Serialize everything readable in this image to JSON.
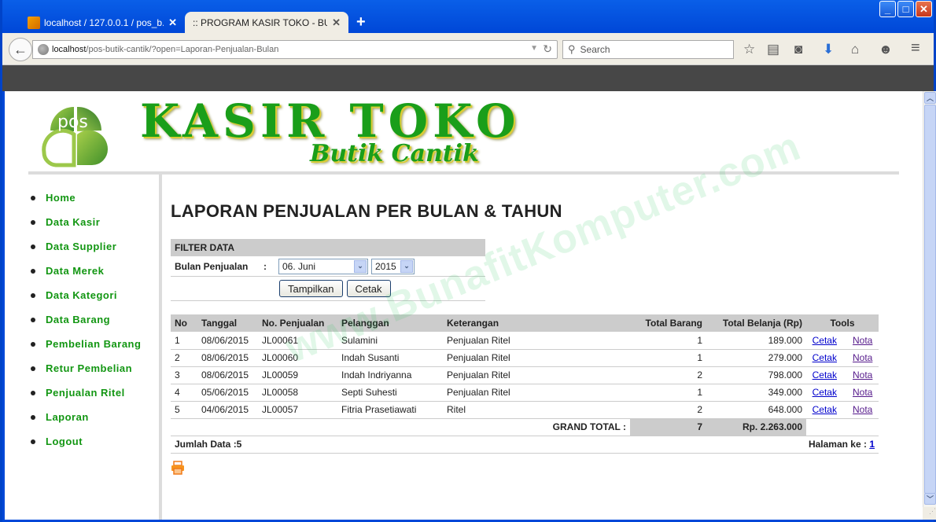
{
  "browser": {
    "tabs": [
      {
        "label": "localhost / 127.0.0.1 / pos_b...",
        "active": false
      },
      {
        "label": ":: PROGRAM KASIR TOKO - BUTIK...",
        "active": true
      }
    ],
    "url_host": "localhost",
    "url_path": "/pos-butik-cantik/?open=Laporan-Penjualan-Bulan",
    "search_placeholder": "Search",
    "window_buttons": {
      "minimize": "_",
      "maximize": "□",
      "close": "✕"
    },
    "new_tab": "+"
  },
  "header": {
    "logo_text": "POS",
    "title": "KASIR TOKO",
    "subtitle": "Butik Cantik",
    "brand_color": "#1a9e1a"
  },
  "sidebar": {
    "items": [
      {
        "label": "Home"
      },
      {
        "label": "Data Kasir"
      },
      {
        "label": "Data Supplier"
      },
      {
        "label": "Data Merek"
      },
      {
        "label": "Data Kategori"
      },
      {
        "label": "Data Barang"
      },
      {
        "label": "Pembelian Barang"
      },
      {
        "label": "Retur Pembelian"
      },
      {
        "label": "Penjualan Ritel"
      },
      {
        "label": "Laporan"
      },
      {
        "label": "Logout"
      }
    ]
  },
  "main": {
    "title": "LAPORAN PENJUALAN PER BULAN & TAHUN",
    "filter": {
      "header": "FILTER DATA",
      "label": "Bulan Penjualan",
      "colon": ":",
      "month_value": "06. Juni",
      "year_value": "2015",
      "show_button": "Tampilkan",
      "print_button": "Cetak"
    },
    "table": {
      "columns": [
        "No",
        "Tanggal",
        "No. Penjualan",
        "Pelanggan",
        "Keterangan",
        "Total Barang",
        "Total Belanja (Rp)",
        "Tools"
      ],
      "rows": [
        {
          "no": "1",
          "tanggal": "08/06/2015",
          "no_penjualan": "JL00061",
          "pelanggan": "Sulamini",
          "keterangan": "Penjualan Ritel",
          "total_barang": "1",
          "total_belanja": "189.000",
          "cetak": "Cetak",
          "nota": "Nota"
        },
        {
          "no": "2",
          "tanggal": "08/06/2015",
          "no_penjualan": "JL00060",
          "pelanggan": "Indah Susanti",
          "keterangan": "Penjualan Ritel",
          "total_barang": "1",
          "total_belanja": "279.000",
          "cetak": "Cetak",
          "nota": "Nota"
        },
        {
          "no": "3",
          "tanggal": "08/06/2015",
          "no_penjualan": "JL00059",
          "pelanggan": "Indah Indriyanna",
          "keterangan": "Penjualan Ritel",
          "total_barang": "2",
          "total_belanja": "798.000",
          "cetak": "Cetak",
          "nota": "Nota"
        },
        {
          "no": "4",
          "tanggal": "05/06/2015",
          "no_penjualan": "JL00058",
          "pelanggan": "Septi Suhesti",
          "keterangan": "Penjualan Ritel",
          "total_barang": "1",
          "total_belanja": "349.000",
          "cetak": "Cetak",
          "nota": "Nota"
        },
        {
          "no": "5",
          "tanggal": "04/06/2015",
          "no_penjualan": "JL00057",
          "pelanggan": "Fitria Prasetiawati",
          "keterangan": "Ritel",
          "total_barang": "2",
          "total_belanja": "648.000",
          "cetak": "Cetak",
          "nota": "Nota"
        }
      ],
      "grand_total_label": "GRAND TOTAL :",
      "grand_total_barang": "7",
      "grand_total_belanja": "Rp. 2.263.000",
      "jumlah_data": "Jumlah Data :5",
      "halaman_label": "Halaman ke : ",
      "halaman_page": "1"
    },
    "watermark": "www.BunafitKomputer.com"
  }
}
